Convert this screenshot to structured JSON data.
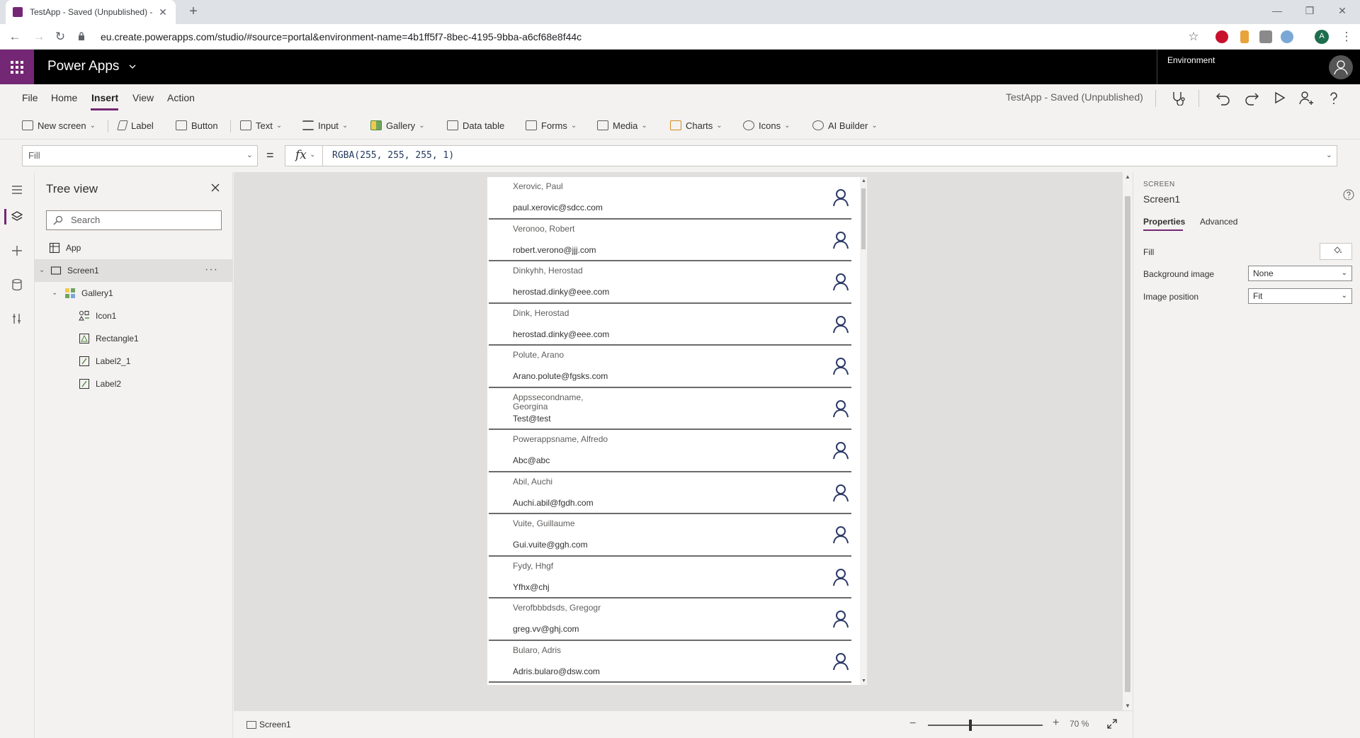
{
  "browser": {
    "tab_title": "TestApp - Saved (Unpublished) -",
    "url": "eu.create.powerapps.com/studio/#source=portal&environment-name=4b1ff5f7-8bec-4195-9bba-a6cf68e8f44c",
    "profile_initial": "A"
  },
  "header": {
    "app_name": "Power Apps",
    "environment_label": "Environment"
  },
  "menu": {
    "items": [
      "File",
      "Home",
      "Insert",
      "View",
      "Action"
    ],
    "status_title": "TestApp - Saved (Unpublished)"
  },
  "insert_toolbar": {
    "items": [
      {
        "label": "New screen",
        "dropdown": true
      },
      {
        "label": "Label",
        "dropdown": false
      },
      {
        "label": "Button",
        "dropdown": false
      },
      {
        "label": "Text",
        "dropdown": true
      },
      {
        "label": "Input",
        "dropdown": true
      },
      {
        "label": "Gallery",
        "dropdown": true
      },
      {
        "label": "Data table",
        "dropdown": false
      },
      {
        "label": "Forms",
        "dropdown": true
      },
      {
        "label": "Media",
        "dropdown": true
      },
      {
        "label": "Charts",
        "dropdown": true
      },
      {
        "label": "Icons",
        "dropdown": true
      },
      {
        "label": "AI Builder",
        "dropdown": true
      }
    ]
  },
  "formula_bar": {
    "property": "Fill",
    "equals": "=",
    "fx": "fx",
    "formula": "RGBA(255, 255, 255, 1)"
  },
  "tree_view": {
    "title": "Tree view",
    "search_placeholder": "Search",
    "nodes": {
      "app": "App",
      "screen1": "Screen1",
      "gallery1": "Gallery1",
      "icon1": "Icon1",
      "rectangle1": "Rectangle1",
      "label2_1": "Label2_1",
      "label2": "Label2"
    }
  },
  "gallery": {
    "rows": [
      {
        "name": "Xerovic, Paul",
        "email": "paul.xerovic@sdcc.com"
      },
      {
        "name": "Veronoo, Robert",
        "email": "robert.verono@jjj.com"
      },
      {
        "name": "Dinkyhh, Herostad",
        "email": "herostad.dinky@eee.com"
      },
      {
        "name": "Dink, Herostad",
        "email": "herostad.dinky@eee.com"
      },
      {
        "name": "Polute, Arano",
        "email": "Arano.polute@fgsks.com"
      },
      {
        "name": "Appssecondname, Georgina",
        "email": "Test@test"
      },
      {
        "name": "Powerappsname, Alfredo",
        "email": "Abc@abc"
      },
      {
        "name": "Abil, Auchi",
        "email": "Auchi.abil@fgdh.com"
      },
      {
        "name": "Vuite, Guillaume",
        "email": "Gui.vuite@ggh.com"
      },
      {
        "name": "Fydy, Hhgf",
        "email": "Yfhx@chj"
      },
      {
        "name": "Verofbbbdsds, Gregogr",
        "email": "greg.vv@ghj.com"
      },
      {
        "name": "Bularo, Adris",
        "email": "Adris.bularo@dsw.com"
      }
    ]
  },
  "bottom_bar": {
    "screen_label": "Screen1",
    "zoom_level": "70 %"
  },
  "properties_panel": {
    "type_label": "SCREEN",
    "name": "Screen1",
    "tabs": {
      "properties": "Properties",
      "advanced": "Advanced"
    },
    "fill_label": "Fill",
    "background_image_label": "Background image",
    "background_image_value": "None",
    "image_position_label": "Image position",
    "image_position_value": "Fit"
  },
  "colors": {
    "brand": "#742774",
    "header_bg": "#000000",
    "canvas_bg": "#e1dfdd"
  }
}
